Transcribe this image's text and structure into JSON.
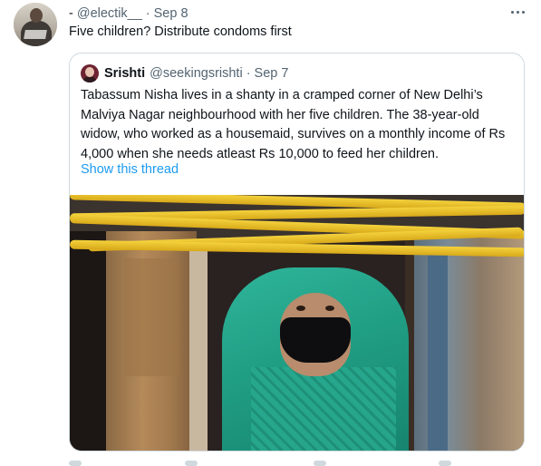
{
  "tweet": {
    "display_name": "-",
    "handle": "@electik__",
    "separator": "·",
    "date": "Sep 8",
    "text": "Five children? Distribute condoms first",
    "more_icon": "more-horizontal-icon"
  },
  "quote": {
    "display_name": "Srishti",
    "handle": "@seekingsrishti",
    "separator": "·",
    "date": "Sep 7",
    "text": "Tabassum Nisha lives in a shanty in a cramped corner of New Delhi’s Malviya Nagar neighbourhood with her five children. The 38-year-old widow, who worked as a housemaid, survives on a monthly income of Rs 4,000 when she needs atleast Rs 10,000 to feed her children.",
    "show_thread": "Show this thread"
  },
  "colors": {
    "text_primary": "#0f1419",
    "text_secondary": "#536471",
    "link": "#1d9bf0",
    "border": "#cfd9de"
  }
}
